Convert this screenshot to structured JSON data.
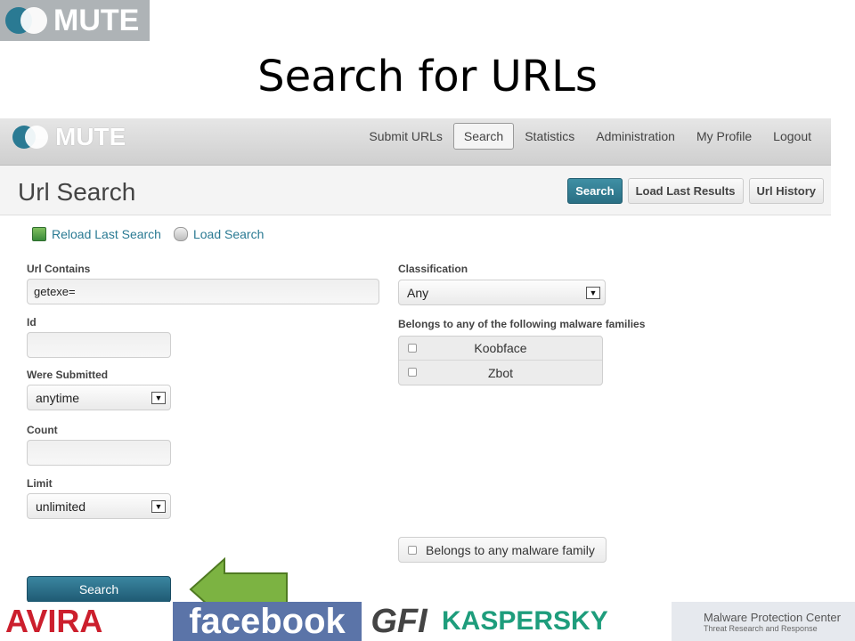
{
  "slide": {
    "logo_text": "MUTE",
    "title": "Search for URLs"
  },
  "app": {
    "logo_text": "MUTE",
    "nav": [
      "Submit URLs",
      "Search",
      "Statistics",
      "Administration",
      "My Profile",
      "Logout"
    ],
    "active_nav": "Search",
    "page_title": "Url Search",
    "header_buttons": [
      "Search",
      "Load Last Results",
      "Url History"
    ]
  },
  "links": {
    "reload": "Reload Last Search",
    "load": "Load Search"
  },
  "form": {
    "url_contains": {
      "label": "Url Contains",
      "value": "getexe="
    },
    "id": {
      "label": "Id",
      "value": ""
    },
    "were_submitted": {
      "label": "Were Submitted",
      "value": "anytime"
    },
    "count": {
      "label": "Count",
      "value": ""
    },
    "limit": {
      "label": "Limit",
      "value": "unlimited"
    },
    "classification": {
      "label": "Classification",
      "value": "Any"
    },
    "families": {
      "label": "Belongs to any of the following malware families",
      "items": [
        "Koobface",
        "Zbot"
      ]
    },
    "any_family": "Belongs to any malware family",
    "search_button": "Search"
  },
  "sponsors": {
    "avira": "AVIRA",
    "facebook": "facebook",
    "gfi": "GFI",
    "kaspersky": "KASPERSKY",
    "mpc_line1": "Malware Protection Center",
    "mpc_line2": "Threat Research and Response"
  },
  "colors": {
    "accent": "#2a7a93",
    "arrow_green": "#7cb342"
  }
}
